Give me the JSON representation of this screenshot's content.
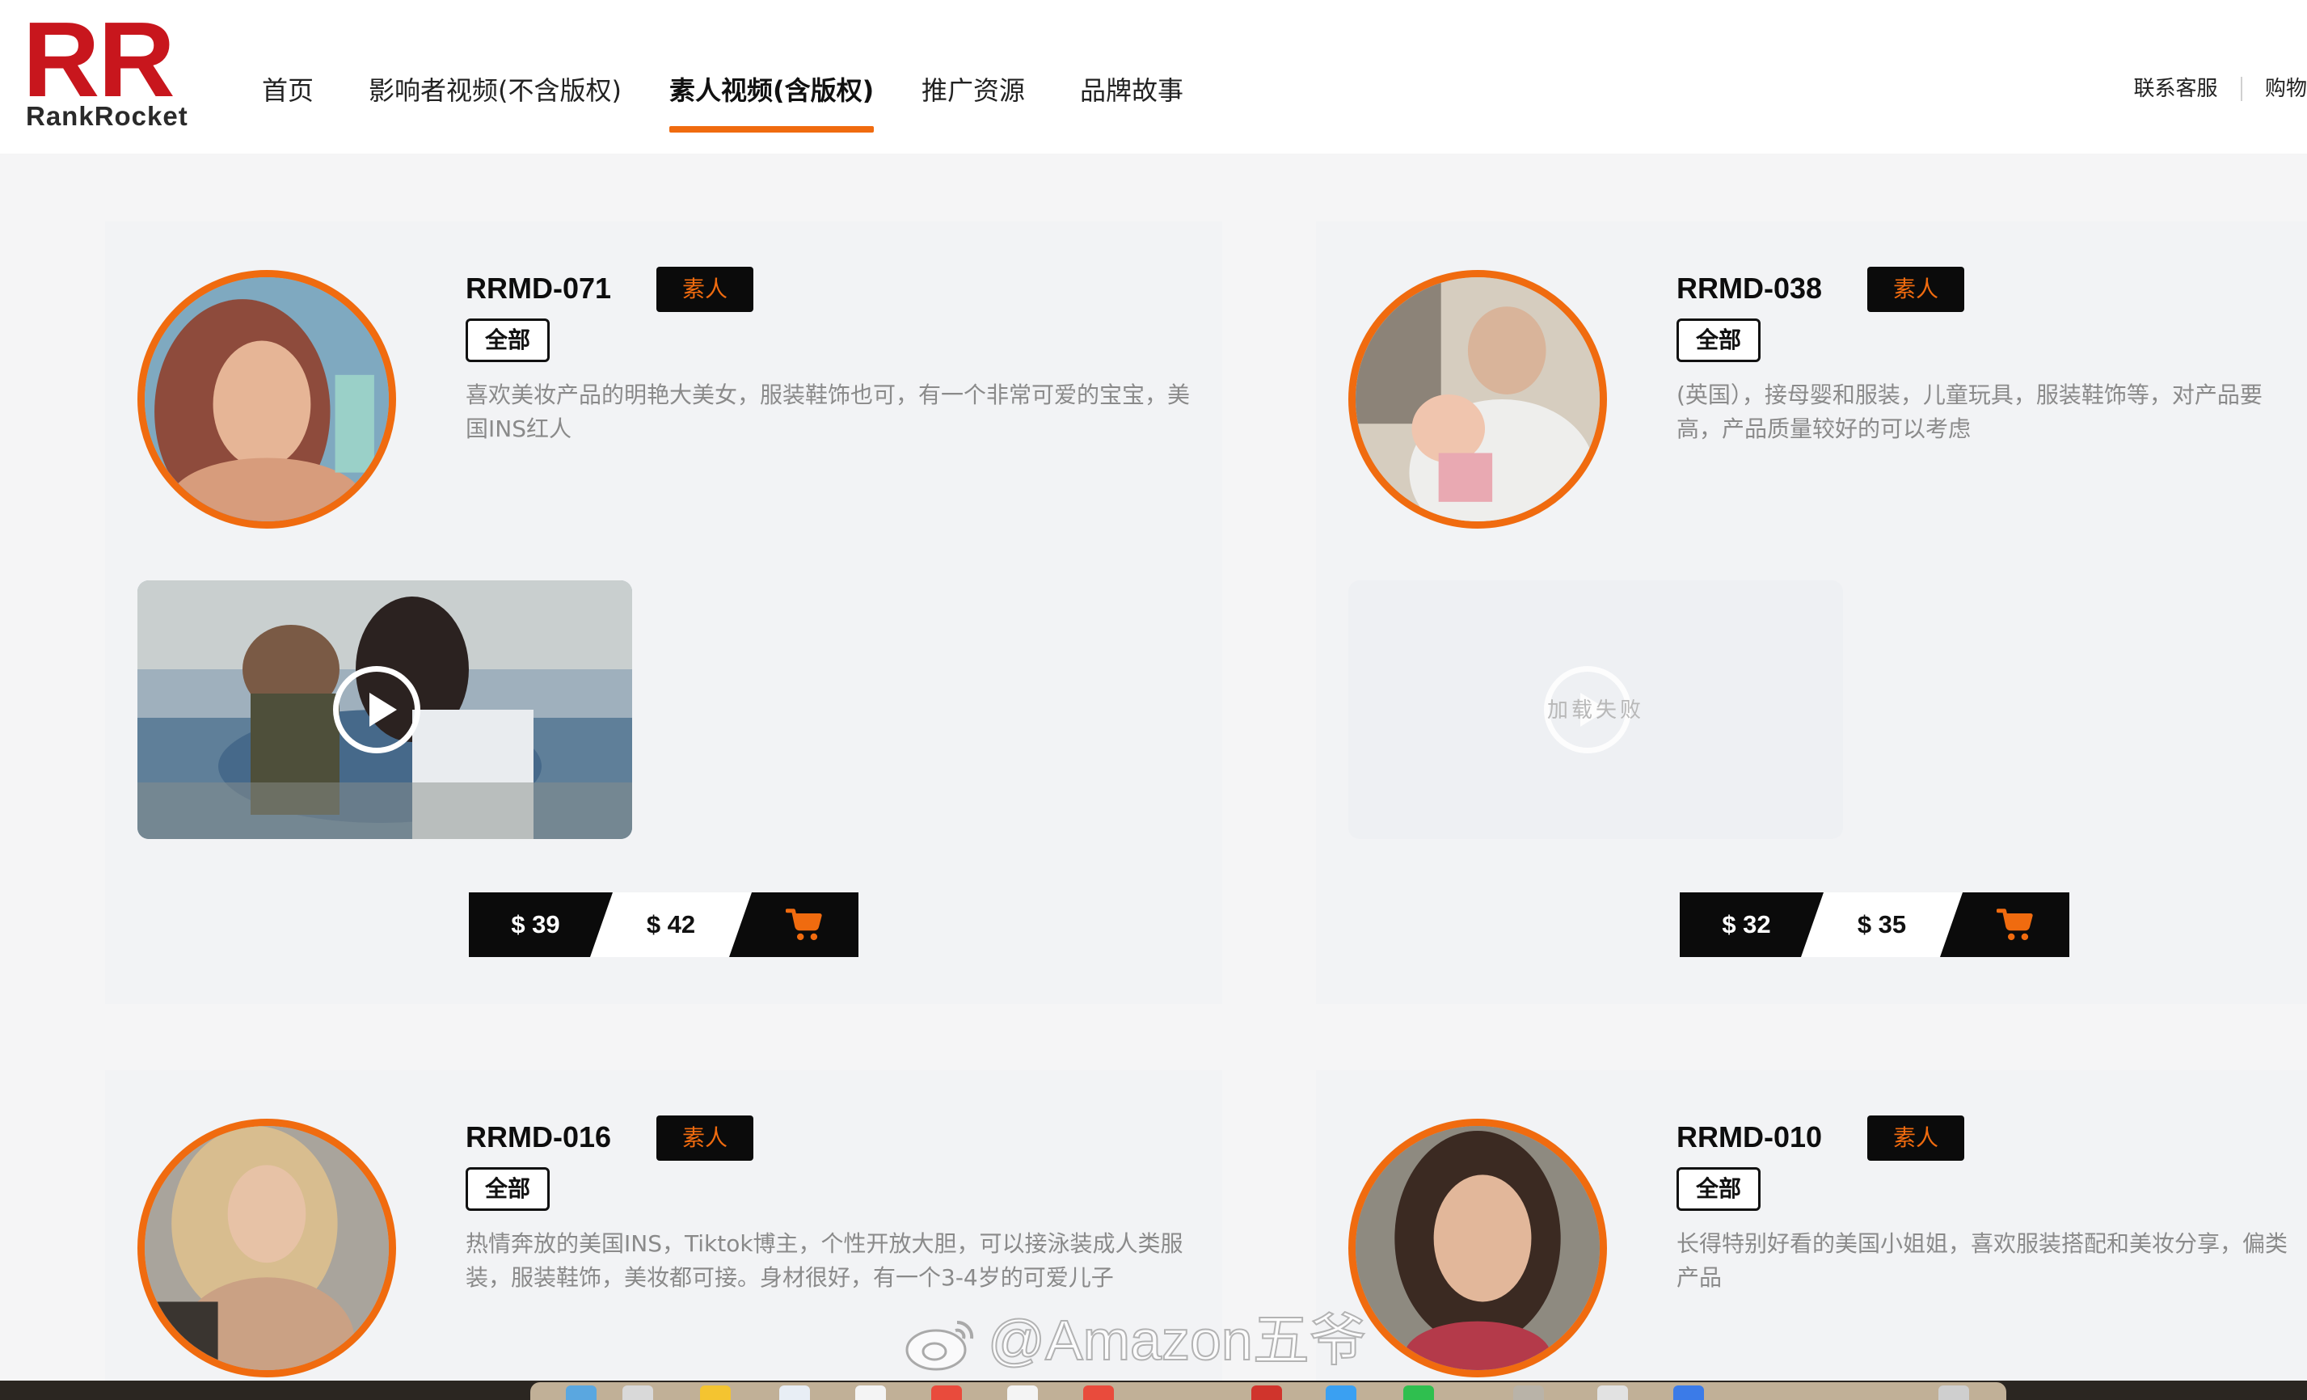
{
  "logo": {
    "mark": "RR",
    "name": "RankRocket"
  },
  "nav": {
    "items": [
      {
        "label": "首页",
        "active": false
      },
      {
        "label": "影响者视频(不含版权)",
        "active": false
      },
      {
        "label": "素人视频(含版权)",
        "active": true
      },
      {
        "label": "推广资源",
        "active": false
      },
      {
        "label": "品牌故事",
        "active": false
      }
    ]
  },
  "header_right": {
    "service": "联系客服",
    "cart": "购物"
  },
  "cards": [
    {
      "code": "RRMD-071",
      "type": "素人",
      "category": "全部",
      "description": "喜欢美妆产品的明艳大美女，服装鞋饰也可，有一个非常可爱的宝宝，美国INS红人",
      "video_loaded": true,
      "price1": "$ 39",
      "price2": "$ 42"
    },
    {
      "code": "RRMD-038",
      "type": "素人",
      "category": "全部",
      "description": "(英国），接母婴和服装，儿童玩具，服装鞋饰等，对产品要高，产品质量较好的可以考虑",
      "video_loaded": false,
      "video_loading_text": "加载失败",
      "price1": "$ 32",
      "price2": "$ 35"
    },
    {
      "code": "RRMD-016",
      "type": "素人",
      "category": "全部",
      "description": "热情奔放的美国INS，Tiktok博主，个性开放大胆，可以接泳装成人类服装，服装鞋饰，美妆都可接。身材很好，有一个3-4岁的可爱儿子"
    },
    {
      "code": "RRMD-010",
      "type": "素人",
      "category": "全部",
      "description": "长得特别好看的美国小姐姐，喜欢服装搭配和美妆分享，偏类产品"
    }
  ],
  "watermark": "@Amazon五爷",
  "colors": {
    "accent": "#f06b0f",
    "brand": "#c8161d",
    "dark": "#0b0b0b"
  },
  "icons": {
    "cart": "shopping-cart-icon",
    "play": "play-icon",
    "watermark": "weibo-icon"
  }
}
